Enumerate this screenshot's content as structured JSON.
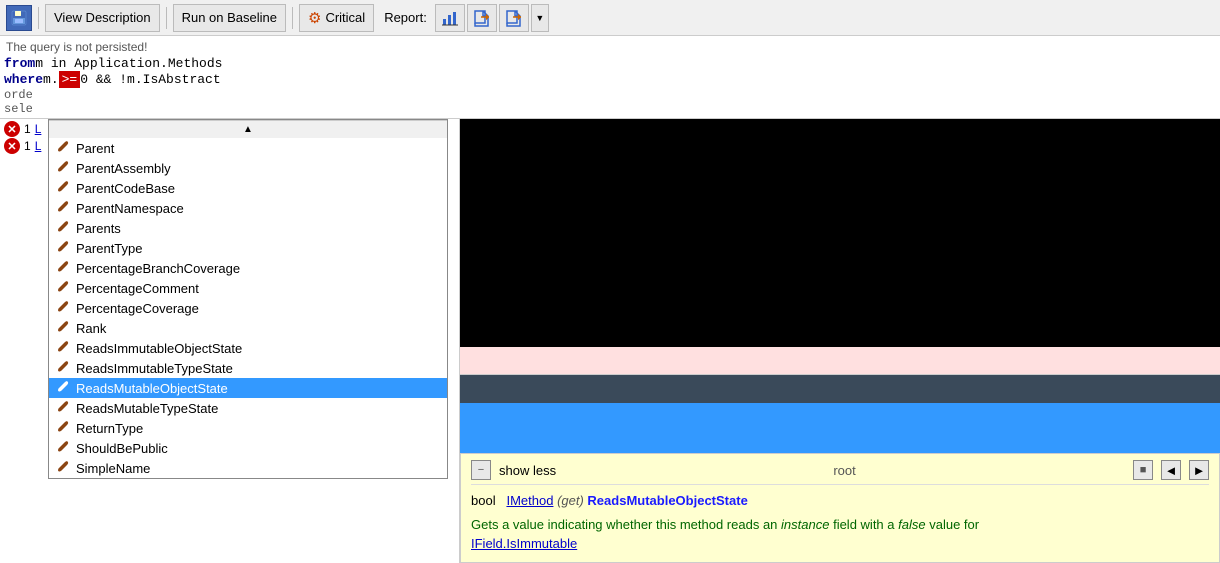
{
  "toolbar": {
    "view_description": "View Description",
    "run_on_baseline": "Run on Baseline",
    "critical": "Critical",
    "report_label": "Report:",
    "dropdown_arrow": "▼"
  },
  "query": {
    "not_persisted": "The query is not persisted!",
    "line1_from": "from",
    "line1_rest": " m in Application.Methods",
    "line2_where": "where",
    "line2_m": " m.",
    "line2_op": ">=",
    "line2_rest": " 0 && !m.IsAbstract",
    "line3": "orde",
    "line4": "sele"
  },
  "error_rows": [
    {
      "id": 1,
      "num": "1",
      "text": "L"
    },
    {
      "id": 2,
      "num": "1",
      "text": "L"
    }
  ],
  "autocomplete": {
    "items": [
      {
        "label": "Parent",
        "selected": false
      },
      {
        "label": "ParentAssembly",
        "selected": false
      },
      {
        "label": "ParentCodeBase",
        "selected": false
      },
      {
        "label": "ParentNamespace",
        "selected": false
      },
      {
        "label": "Parents",
        "selected": false
      },
      {
        "label": "ParentType",
        "selected": false
      },
      {
        "label": "PercentageBranchCoverage",
        "selected": false
      },
      {
        "label": "PercentageComment",
        "selected": false
      },
      {
        "label": "PercentageCoverage",
        "selected": false
      },
      {
        "label": "Rank",
        "selected": false
      },
      {
        "label": "ReadsImmutableObjectState",
        "selected": false
      },
      {
        "label": "ReadsImmutableTypeState",
        "selected": false
      },
      {
        "label": "ReadsMutableObjectState",
        "selected": true
      },
      {
        "label": "ReadsMutableTypeState",
        "selected": false
      },
      {
        "label": "ReturnType",
        "selected": false
      },
      {
        "label": "ShouldBePublic",
        "selected": false
      },
      {
        "label": "SimpleName",
        "selected": false
      }
    ]
  },
  "description": {
    "show_less": "show less",
    "root": "root",
    "stop": "■",
    "back": "◄",
    "forward": "►",
    "type": "bool",
    "interface": "IMethod",
    "get": "(get)",
    "property": "ReadsMutableObjectState",
    "body": "Gets a value indicating whether this method reads an",
    "italic1": "instance",
    "body2": "field with a",
    "italic2": "false",
    "body3": "value for",
    "link": "IField.IsImmutable"
  }
}
